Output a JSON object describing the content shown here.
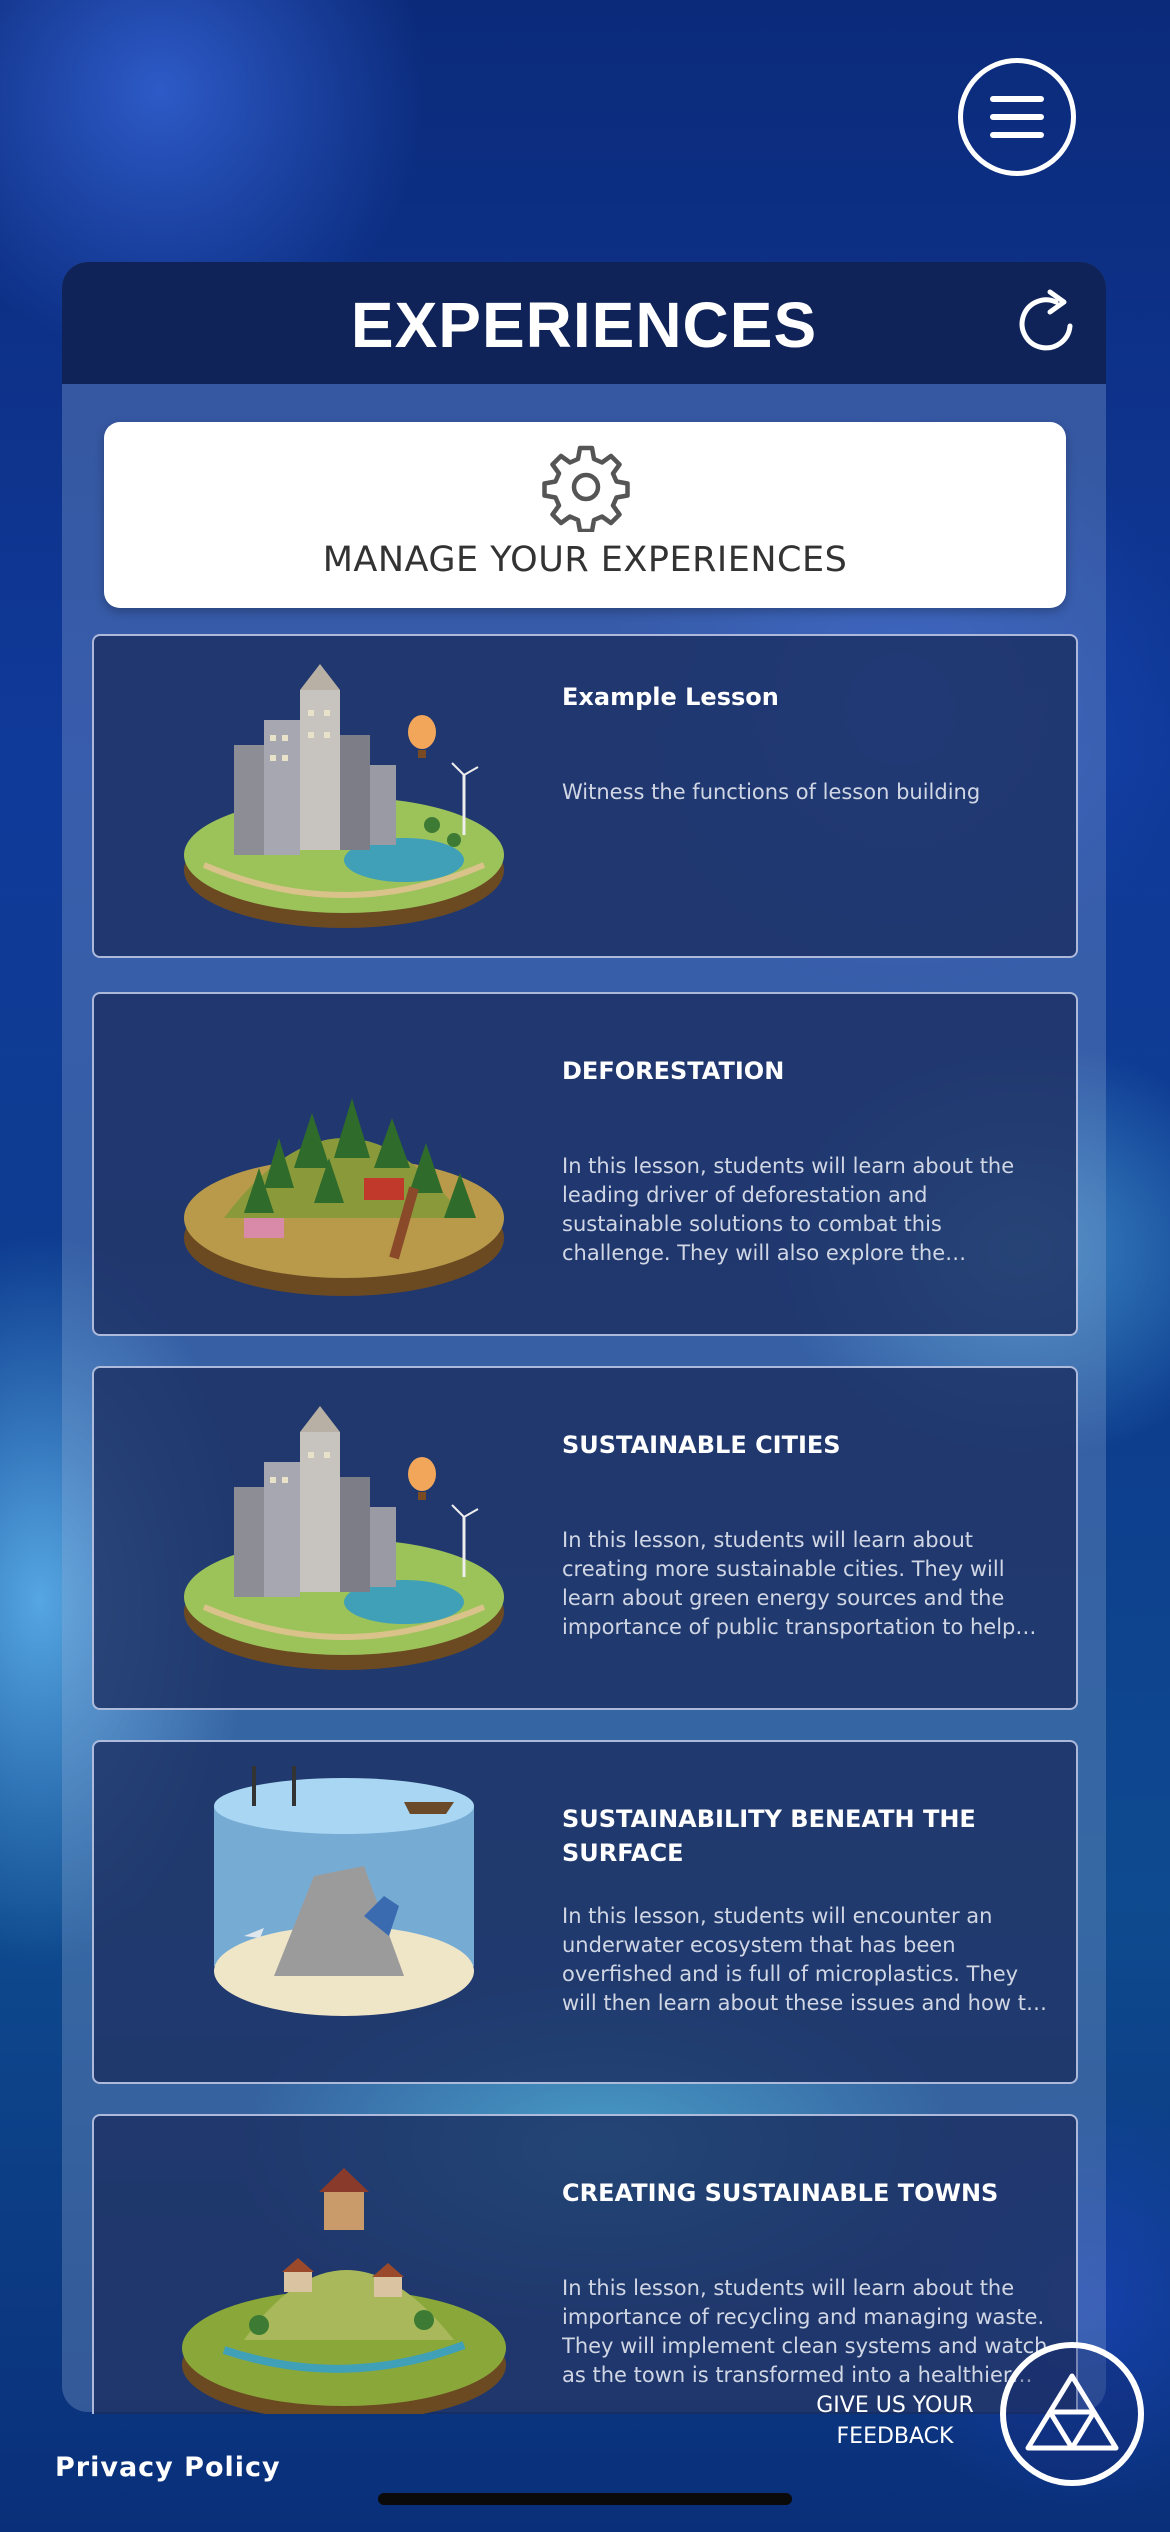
{
  "header": {
    "title": "EXPERIENCES"
  },
  "manage": {
    "label": "MANAGE YOUR EXPERIENCES"
  },
  "experiences": [
    {
      "title": "Example Lesson",
      "description": "Witness the functions of lesson building",
      "icon": "city-diorama"
    },
    {
      "title": "DEFORESTATION",
      "description": "In this lesson, students will learn about the leading driver of deforestation and sustainable solutions to combat this challenge. They will also explore the importance of soil health and protecting biodi…",
      "icon": "forest-diorama"
    },
    {
      "title": "SUSTAINABLE CITIES",
      "description": "In this lesson, students will learn about creating more sustainable cities. They will learn about green energy sources and the importance of public transportation to help lower carbon emissi…",
      "icon": "city-diorama"
    },
    {
      "title": "SUSTAINABILITY BENEATH THE SURFACE",
      "description": "In this lesson, students will encounter an underwater ecosystem that has been overfished and is full of microplastics. They will then learn about these issues and how to regenerate our oc…",
      "icon": "ocean-diorama"
    },
    {
      "title": "CREATING SUSTAINABLE TOWNS",
      "description": "In this lesson, students will learn about the importance of recycling and managing waste. They will implement clean systems and watch as the town is transformed into a healthier environ…",
      "icon": "town-diorama"
    }
  ],
  "footer": {
    "privacy_label": "Privacy Policy",
    "feedback_line1": "GIVE US YOUR",
    "feedback_line2": "FEEDBACK"
  },
  "icons": {
    "menu": "hamburger-menu-icon",
    "refresh": "refresh-icon",
    "manage": "gear-icon",
    "feedback": "triangle-logo-icon"
  },
  "colors": {
    "header_bg": "#0f2358",
    "card_bg": "#192d5f",
    "accent_white": "#ffffff"
  }
}
